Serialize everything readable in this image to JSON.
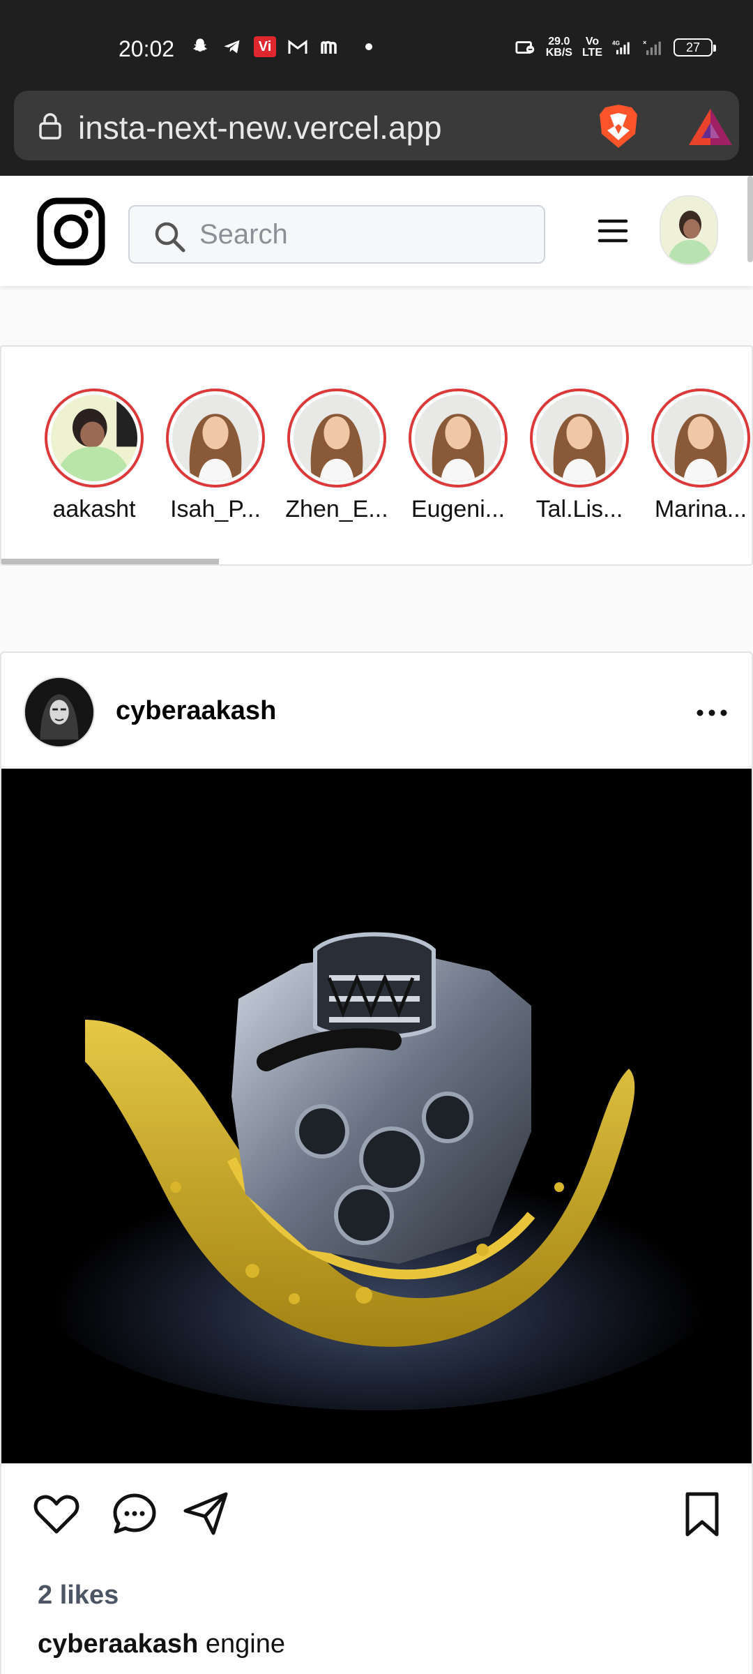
{
  "status_bar": {
    "time": "20:02",
    "net_speed_top": "29.0",
    "net_speed_bottom": "KB/S",
    "volte_top": "Vo",
    "volte_bottom": "LTE",
    "network": "4G",
    "battery": "27",
    "carrier_badge": "Vi"
  },
  "browser": {
    "url": "insta-next-new.vercel.app"
  },
  "header": {
    "search_placeholder": "Search"
  },
  "stories": [
    {
      "name": "aakasht"
    },
    {
      "name": "Isah_P..."
    },
    {
      "name": "Zhen_E..."
    },
    {
      "name": "Eugeni..."
    },
    {
      "name": "Tal.Lis..."
    },
    {
      "name": "Marina..."
    }
  ],
  "post": {
    "username": "cyberaakash",
    "likes": "2 likes",
    "caption_user": "cyberaakash",
    "caption_text": "engine"
  },
  "colors": {
    "story_ring": "#dc3a3a",
    "status_bar_bg": "#1f1f1f",
    "url_box_bg": "#3a3a3a"
  }
}
